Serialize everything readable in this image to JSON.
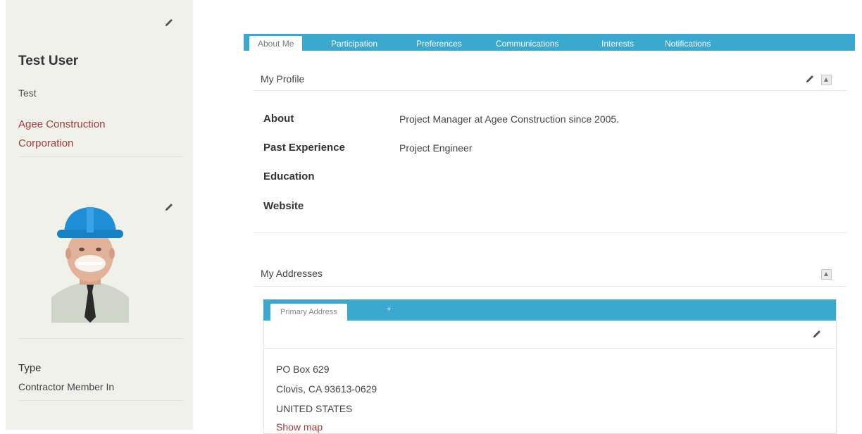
{
  "sidebar": {
    "name": "Test User",
    "subtitle": "Test",
    "organization": "Agee Construction Corporation",
    "type_label": "Type",
    "type_value": "Contractor Member In"
  },
  "tabs": [
    {
      "label": "About Me",
      "active": true
    },
    {
      "label": "Participation",
      "active": false
    },
    {
      "label": "Preferences",
      "active": false
    },
    {
      "label": "Communications",
      "active": false
    },
    {
      "label": "Interests",
      "active": false
    },
    {
      "label": "Notifications",
      "active": false
    }
  ],
  "profile": {
    "title": "My Profile",
    "fields": [
      {
        "label": "About",
        "value": "Project Manager at Agee Construction since 2005."
      },
      {
        "label": "Past Experience",
        "value": "Project Engineer"
      },
      {
        "label": "Education",
        "value": ""
      },
      {
        "label": "Website",
        "value": ""
      }
    ]
  },
  "addresses": {
    "title": "My Addresses",
    "tab_label": "Primary Address",
    "add_label": "+",
    "lines": [
      "PO Box 629",
      "Clovis, CA 93613-0629",
      "UNITED STATES"
    ],
    "show_map_label": "Show map"
  },
  "colors": {
    "accent": "#3aa8cf",
    "link": "#a63a3a",
    "sidebar_bg": "#f1f1ec"
  }
}
